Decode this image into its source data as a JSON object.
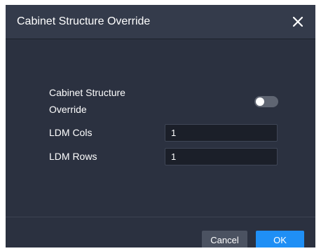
{
  "dialog": {
    "title": "Cabinet Structure Override",
    "close_icon": "close-icon"
  },
  "form": {
    "override_label_line1": "Cabinet Structure",
    "override_label_line2": "Override",
    "override_toggle_on": false,
    "cols_label": "LDM Cols",
    "cols_value": "1",
    "rows_label": "LDM Rows",
    "rows_value": "1"
  },
  "footer": {
    "cancel_label": "Cancel",
    "ok_label": "OK"
  },
  "colors": {
    "background": "#2b3140",
    "titlebar": "#343b4b",
    "input_bg": "#1b1f29",
    "ok_button": "#1f8ff5",
    "cancel_button": "#4b5261",
    "toggle_off": "#5f6572"
  }
}
